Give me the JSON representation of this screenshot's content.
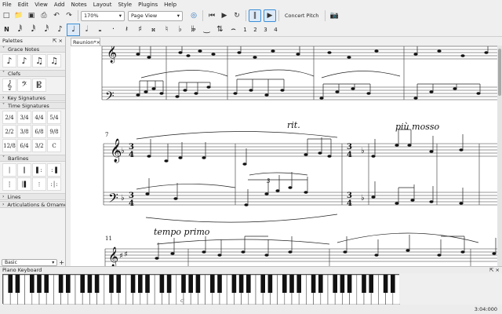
{
  "menu": [
    "File",
    "Edit",
    "View",
    "Add",
    "Notes",
    "Layout",
    "Style",
    "Plugins",
    "Help"
  ],
  "toolbar": {
    "zoom_value": "170%",
    "view_mode": "Page View",
    "concert_pitch_label": "Concert Pitch"
  },
  "note_input": {
    "voices": [
      "1",
      "2",
      "3",
      "4"
    ]
  },
  "palettes": {
    "title": "Palettes",
    "sections": {
      "grace_notes": "Grace Notes",
      "clefs": "Clefs",
      "key_signatures": "Key Signatures",
      "time_signatures": "Time Signatures",
      "barlines": "Barlines",
      "lines": "Lines",
      "articulations": "Articulations & Ornaments"
    },
    "time_sig_cells": [
      "2/4",
      "3/4",
      "4/4",
      "5/4",
      "2/2",
      "3/8",
      "6/8",
      "9/8",
      "12/8",
      "6/4",
      "3/2",
      "C"
    ],
    "workspace": "Basic"
  },
  "document_tab": "Reunion*",
  "score": {
    "measure_number_1": "7",
    "measure_number_2": "11",
    "rit_text": "rit.",
    "piu_mosso_text": "più mosso",
    "tempo_primo_text": "tempo primo",
    "time_sig_top": "3",
    "time_sig_bottom": "4",
    "triplet": "3"
  },
  "piano_keyboard": {
    "title": "Piano Keyboard",
    "c_label": "c'"
  },
  "status": {
    "time": "3:04:000"
  }
}
